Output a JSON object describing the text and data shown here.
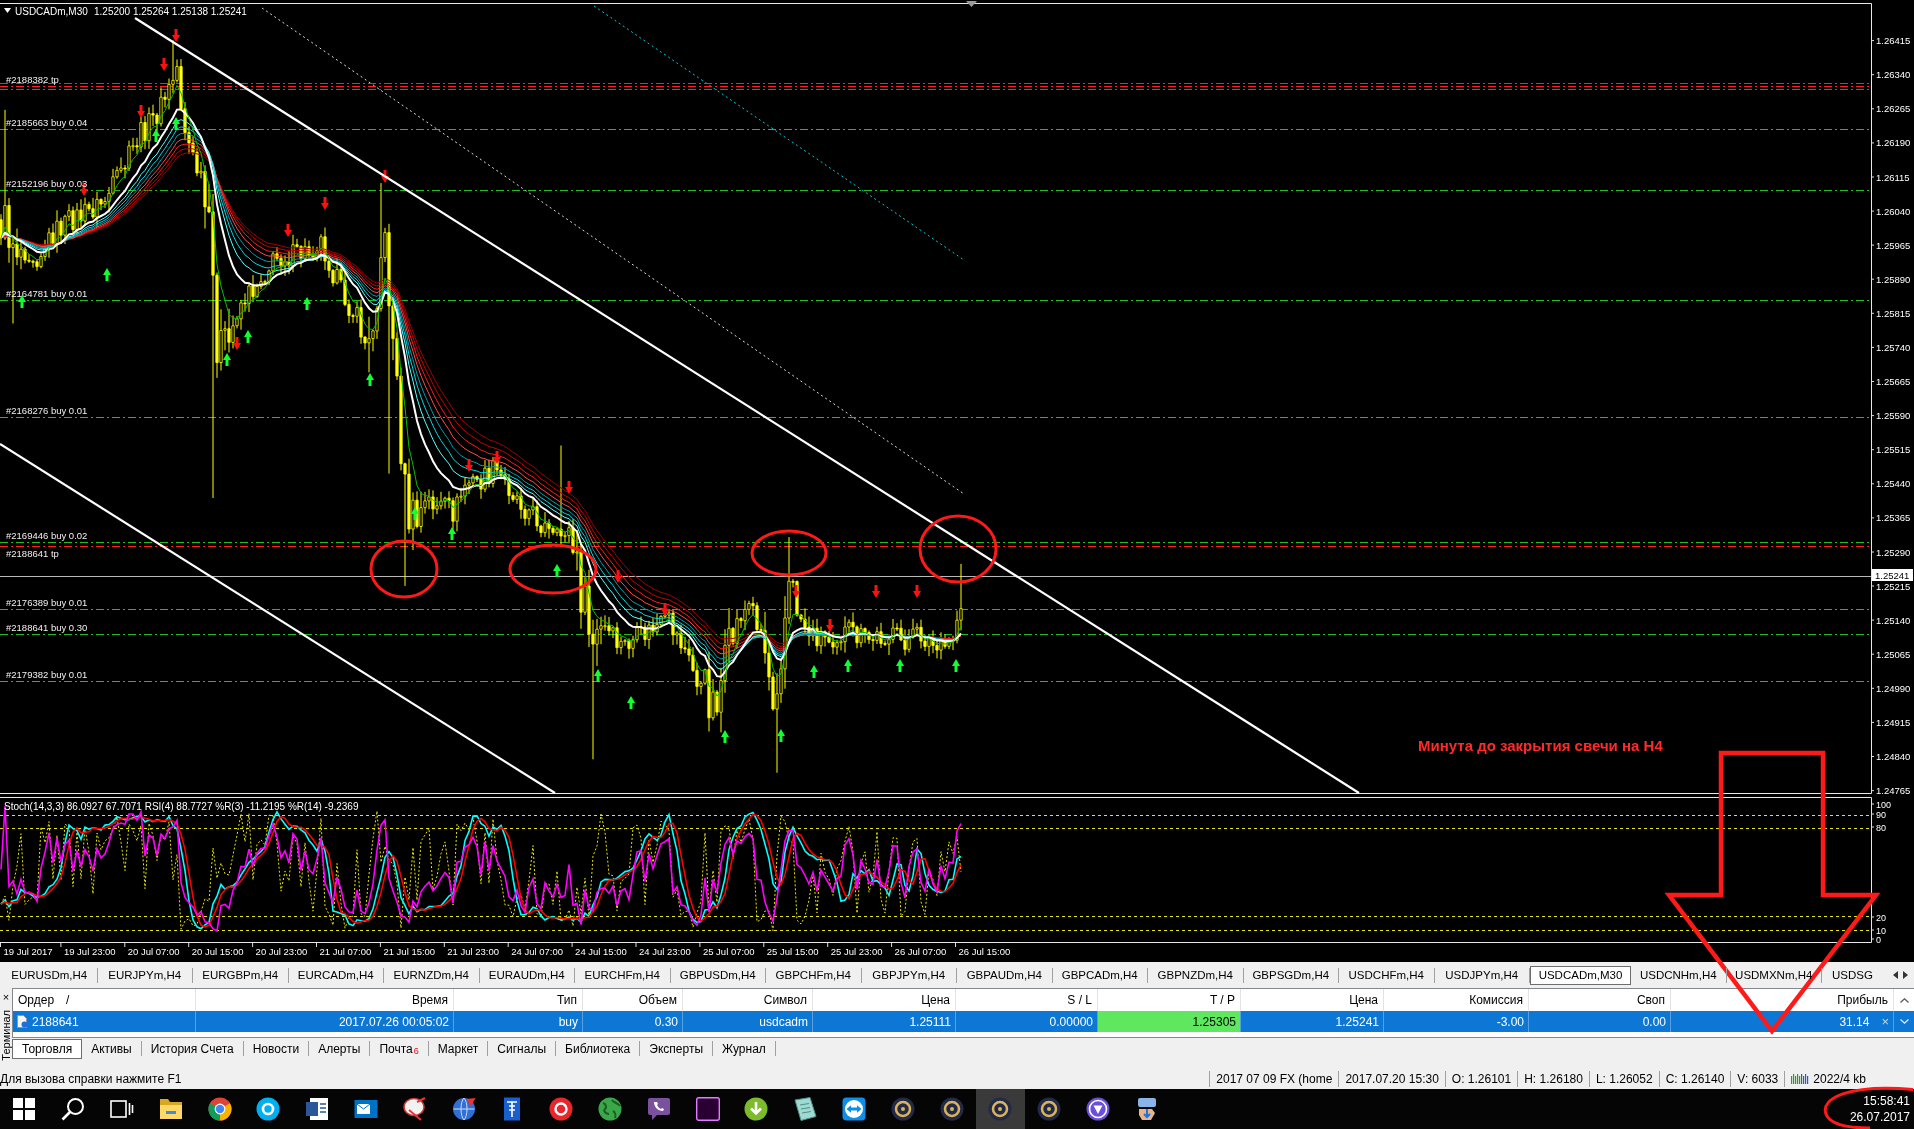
{
  "chart": {
    "title": "USDCADm,M30",
    "ohlc": "1.25200 1.25264 1.25138 1.25241",
    "order_lines": [
      {
        "label": "#2188382 tp",
        "kind": "tp"
      },
      {
        "label": "#2185663 buy 0.04",
        "kind": "buy"
      },
      {
        "label": "#2152196 buy 0.03",
        "kind": "buy"
      },
      {
        "label": "#2164781 buy 0.01",
        "kind": "buy"
      },
      {
        "label": "#2168276 buy 0.01",
        "kind": "buy"
      },
      {
        "label": "#2169446 buy 0.02",
        "kind": "buy"
      },
      {
        "label": "#2188641 tp",
        "kind": "tp"
      },
      {
        "label": "#2176389 buy 0.01",
        "kind": "buy"
      },
      {
        "label": "#2188641 buy 0.30",
        "kind": "buy"
      },
      {
        "label": "#2179382 buy 0.01",
        "kind": "buy"
      }
    ],
    "price_axis": [
      "1.26415",
      "1.26340",
      "1.26265",
      "1.26190",
      "1.26115",
      "1.26040",
      "1.25965",
      "1.25890",
      "1.25815",
      "1.25740",
      "1.25665",
      "1.25590",
      "1.25515",
      "1.25440",
      "1.25365",
      "1.25290",
      "1.25215",
      "1.25140",
      "1.25065",
      "1.24990",
      "1.24915",
      "1.24840",
      "1.24765"
    ],
    "current_price": "1.25241",
    "note": "Минута до закрытия свечи на H4",
    "indicator": {
      "legend": "Stoch(14,3,3) 86.0927 67.7071 RSI(4) 88.7727 %R(3) -11.2195 %R(14) -9.2369",
      "levels": [
        "100",
        "90",
        "80",
        "20",
        "10",
        "0"
      ]
    },
    "time_axis": [
      "19 Jul 2017",
      "19 Jul 23:00",
      "20 Jul 07:00",
      "20 Jul 15:00",
      "20 Jul 23:00",
      "21 Jul 07:00",
      "21 Jul 15:00",
      "21 Jul 23:00",
      "24 Jul 07:00",
      "24 Jul 15:00",
      "24 Jul 23:00",
      "25 Jul 07:00",
      "25 Jul 15:00",
      "25 Jul 23:00",
      "26 Jul 07:00",
      "26 Jul 15:00"
    ]
  },
  "symbol_tabs": [
    {
      "label": "EURUSDm,H4",
      "selected": false
    },
    {
      "label": "EURJPYm,H4",
      "selected": false
    },
    {
      "label": "EURGBPm,H4",
      "selected": false
    },
    {
      "label": "EURCADm,H4",
      "selected": false
    },
    {
      "label": "EURNZDm,H4",
      "selected": false
    },
    {
      "label": "EURAUDm,H4",
      "selected": false
    },
    {
      "label": "EURCHFm,H4",
      "selected": false
    },
    {
      "label": "GBPUSDm,H4",
      "selected": false
    },
    {
      "label": "GBPCHFm,H4",
      "selected": false
    },
    {
      "label": "GBPJPYm,H4",
      "selected": false
    },
    {
      "label": "GBPAUDm,H4",
      "selected": false
    },
    {
      "label": "GBPCADm,H4",
      "selected": false
    },
    {
      "label": "GBPNZDm,H4",
      "selected": false
    },
    {
      "label": "GBPSGDm,H4",
      "selected": false
    },
    {
      "label": "USDCHFm,H4",
      "selected": false
    },
    {
      "label": "USDJPYm,H4",
      "selected": false
    },
    {
      "label": "USDCADm,M30",
      "selected": true
    },
    {
      "label": "USDCNHm,H4",
      "selected": false
    },
    {
      "label": "USDMXNm,H4",
      "selected": false
    },
    {
      "label": "USDSG",
      "selected": false
    }
  ],
  "terminal": {
    "title": "Терминал",
    "close": "×",
    "columns": [
      "Ордер",
      "Время",
      "Тип",
      "Объем",
      "Символ",
      "Цена",
      "S / L",
      "T / P",
      "Цена",
      "Комиссия",
      "Своп",
      "Прибыль"
    ],
    "sort_mark": "/",
    "rows": [
      {
        "selected": true,
        "close": "×",
        "cells": [
          {
            "text": "2188641",
            "highlighted": false
          },
          {
            "text": "2017.07.26 00:05:02",
            "highlighted": false
          },
          {
            "text": "buy",
            "highlighted": false
          },
          {
            "text": "0.30",
            "highlighted": false
          },
          {
            "text": "usdcadm",
            "highlighted": false
          },
          {
            "text": "1.25111",
            "highlighted": false
          },
          {
            "text": "0.00000",
            "highlighted": false
          },
          {
            "text": "1.25305",
            "highlighted": true
          },
          {
            "text": "1.25241",
            "highlighted": false
          },
          {
            "text": "-3.00",
            "highlighted": false
          },
          {
            "text": "0.00",
            "highlighted": false
          },
          {
            "text": "31.14",
            "highlighted": false
          }
        ]
      }
    ],
    "tabs": [
      {
        "label": "Торговля",
        "selected": true
      },
      {
        "label": "Активы",
        "selected": false
      },
      {
        "label": "История Счета",
        "selected": false
      },
      {
        "label": "Новости",
        "selected": false
      },
      {
        "label": "Алерты",
        "selected": false
      },
      {
        "label": "Почта",
        "badge": "6",
        "selected": false
      },
      {
        "label": "Маркет",
        "selected": false
      },
      {
        "label": "Сигналы",
        "selected": false
      },
      {
        "label": "Библиотека",
        "selected": false
      },
      {
        "label": "Эксперты",
        "selected": false
      },
      {
        "label": "Журнал",
        "selected": false
      }
    ]
  },
  "status_bar": {
    "help": "Для вызова справки нажмите F1",
    "fields": [
      "2017 07 09 FX (home",
      "2017.07.20 15:30",
      "O: 1.26101",
      "H: 1.26180",
      "L: 1.26052",
      "C: 1.26140",
      "V: 6033"
    ],
    "traffic": "2022/4 kb"
  },
  "taskbar": {
    "apps": [
      {
        "kind": "start",
        "active": false
      },
      {
        "kind": "search",
        "active": false
      },
      {
        "kind": "task_view",
        "active": false
      },
      {
        "kind": "folder",
        "active": false
      },
      {
        "kind": "browser",
        "active": false
      },
      {
        "kind": "messenger",
        "active": false
      },
      {
        "kind": "document",
        "active": false
      },
      {
        "kind": "mail",
        "active": false
      },
      {
        "kind": "dish",
        "active": false
      },
      {
        "kind": "globe",
        "active": false
      },
      {
        "kind": "tower",
        "active": false
      },
      {
        "kind": "badge",
        "active": false
      },
      {
        "kind": "earth",
        "active": false
      },
      {
        "kind": "chat",
        "active": false
      },
      {
        "kind": "video",
        "active": false
      },
      {
        "kind": "torrent",
        "active": false
      },
      {
        "kind": "notes",
        "active": false
      },
      {
        "kind": "remote",
        "active": false
      },
      {
        "kind": "terminal",
        "active": false
      },
      {
        "kind": "terminal",
        "active": false
      },
      {
        "kind": "terminal",
        "active": true
      },
      {
        "kind": "terminal",
        "active": false
      },
      {
        "kind": "shield",
        "active": false
      },
      {
        "kind": "hand",
        "active": false
      }
    ],
    "time": "15:58:41",
    "date": "26.07.2017"
  }
}
